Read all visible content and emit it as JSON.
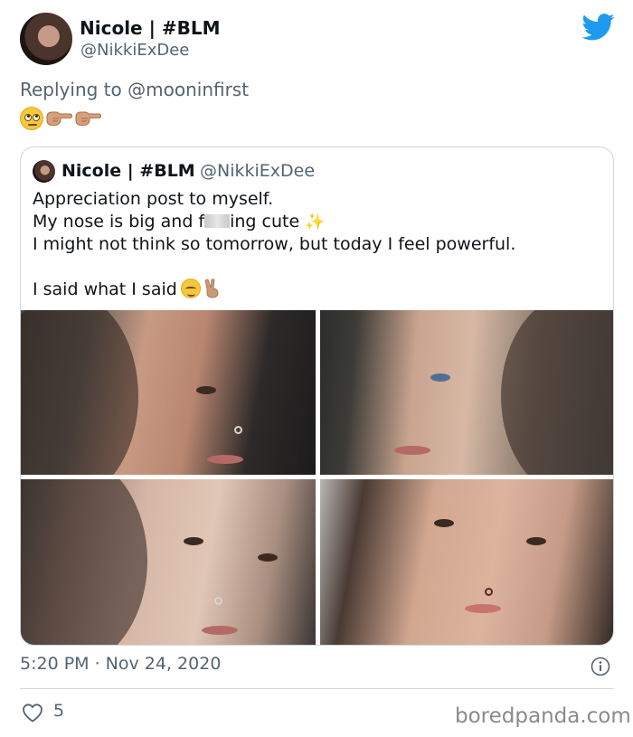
{
  "author": {
    "name": "Nicole | #BLM",
    "handle": "@NikkiExDee"
  },
  "reply": {
    "prefix": "Replying to ",
    "mention": "@mooninfirst",
    "emojis": [
      "face-with-rolling-eyes-emoji",
      "backhand-index-pointing-right-emoji",
      "backhand-index-pointing-right-emoji"
    ]
  },
  "quoted": {
    "name": "Nicole | #BLM",
    "handle": "@NikkiExDee",
    "line1": "Appreciation post to myself.",
    "line2_before": "My nose is big and f",
    "line2_after": "ing cute",
    "sparkles": "✨",
    "line3": "I might not think so tomorrow, but today I feel powerful.",
    "line4": "I said what I said",
    "photo_count": 4
  },
  "meta": {
    "timestamp": "5:20 PM · Nov 24, 2020",
    "likes": "5"
  },
  "watermark": "boredpanda.com",
  "colors": {
    "brand": "#1d9bf0",
    "text": "#0f1419",
    "secondary": "#536471",
    "border": "#cfd9de"
  }
}
